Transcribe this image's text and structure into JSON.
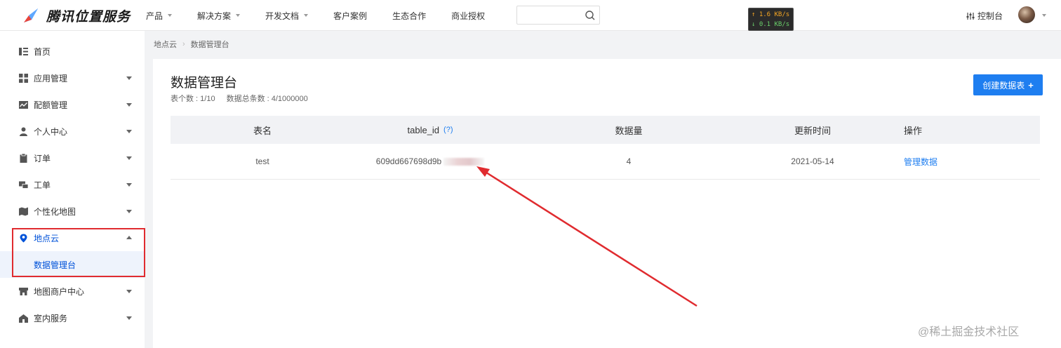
{
  "header": {
    "brand": "腾讯位置服务",
    "nav": [
      {
        "label": "产品",
        "has_caret": true
      },
      {
        "label": "解决方案",
        "has_caret": true
      },
      {
        "label": "开发文档",
        "has_caret": true
      },
      {
        "label": "客户案例",
        "has_caret": false
      },
      {
        "label": "生态合作",
        "has_caret": false
      },
      {
        "label": "商业授权",
        "has_caret": false
      }
    ],
    "search": {
      "value": "",
      "placeholder": ""
    },
    "speed": {
      "up": "↑ 1.6 KB/s",
      "down": "↓ 0.1 KB/s"
    },
    "console_label": "控制台"
  },
  "sidebar": {
    "items": [
      {
        "label": "首页",
        "icon": "home-list-icon"
      },
      {
        "label": "应用管理",
        "icon": "grid-icon"
      },
      {
        "label": "配额管理",
        "icon": "chart-icon"
      },
      {
        "label": "个人中心",
        "icon": "user-icon"
      },
      {
        "label": "订单",
        "icon": "clipboard-icon"
      },
      {
        "label": "工单",
        "icon": "ticket-icon"
      },
      {
        "label": "个性化地图",
        "icon": "map-style-icon"
      },
      {
        "label": "地点云",
        "icon": "location-pin-icon"
      },
      {
        "label": "地图商户中心",
        "icon": "shop-icon"
      },
      {
        "label": "室内服务",
        "icon": "building-icon"
      }
    ],
    "sub_item": "数据管理台"
  },
  "breadcrumb": {
    "parent": "地点云",
    "current": "数据管理台"
  },
  "page": {
    "title": "数据管理台",
    "table_count": "表个数 : 1/10",
    "record_count": "数据总条数 : 4/1000000",
    "create_button": "创建数据表"
  },
  "table": {
    "headers": {
      "name": "表名",
      "table_id": "table_id",
      "help": "(?)",
      "count": "数据量",
      "updated": "更新时间",
      "action": "操作"
    },
    "rows": [
      {
        "name": "test",
        "table_id": "609dd667698d9b",
        "count": "4",
        "updated": "2021-05-14",
        "action": "管理数据"
      }
    ]
  },
  "colors": {
    "accent": "#1e7ef0",
    "annotation": "#e02b2f"
  },
  "watermark": "@稀土掘金技术社区"
}
